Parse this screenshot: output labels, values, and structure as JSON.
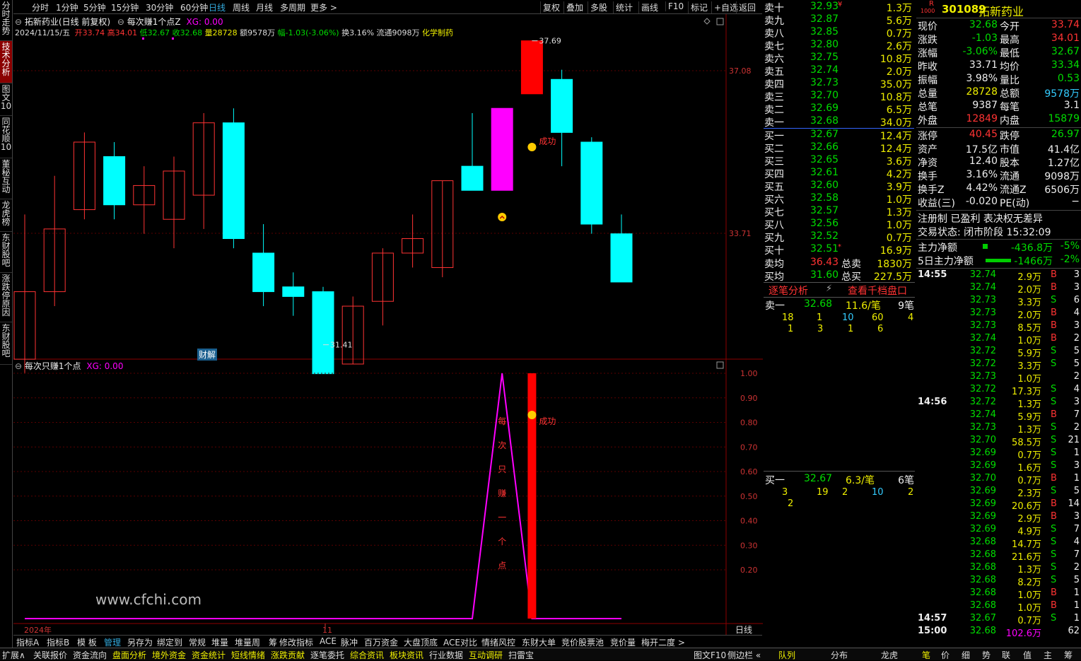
{
  "left_sidebar": [
    {
      "label": "分时走势",
      "active": false
    },
    {
      "label": "技术分析",
      "active": true
    },
    {
      "label": "图文10",
      "active": false
    },
    {
      "label": "同花顺10",
      "active": false
    },
    {
      "label": "董秘互动",
      "active": false
    },
    {
      "label": "龙虎榜",
      "active": false
    },
    {
      "label": "东财股吧",
      "active": false
    },
    {
      "label": "涨跌停原因",
      "active": false
    },
    {
      "label": "东财股吧",
      "active": false
    }
  ],
  "period_tabs": [
    "分时",
    "1分钟",
    "5分钟",
    "15分钟",
    "30分钟",
    "60分钟",
    "日线",
    "周线",
    "月线",
    "多周期",
    "更多 >"
  ],
  "active_period": "日线",
  "top_tools": [
    "复权",
    "叠加",
    "多股",
    "统计",
    "画线",
    "F10",
    "标记",
    "+自选",
    "返回"
  ],
  "kline": {
    "title": "拓新药业(日线 前复权)",
    "indicator": "每次赚1个点Z",
    "xg": "XG: 0.00",
    "date": "2024/11/15/五",
    "open_lbl": "开",
    "open": "33.74",
    "high_lbl": "高",
    "high": "34.01",
    "low_lbl": "低",
    "low": "32.67",
    "close_lbl": "收",
    "close": "32.68",
    "vol_lbl": "量",
    "vol": "28728",
    "amt": "额9578万",
    "chg": "幅-1.03(-3.06%)",
    "turnover": "换3.16%",
    "circ": "流通9098万",
    "sector": "化学制药",
    "price_labels": [
      "37.08",
      "33.71"
    ],
    "max_label": "37.69",
    "min_label": "31.41",
    "success": "成功",
    "caijie": "财解"
  },
  "chart_data": {
    "type": "candlestick",
    "candles": [
      {
        "o": 31.1,
        "h": 34.1,
        "l": 30.8,
        "c": 32.5
      },
      {
        "o": 32.5,
        "h": 34.9,
        "l": 32.2,
        "c": 33.8
      },
      {
        "o": 34.2,
        "h": 35.8,
        "l": 34.0,
        "c": 35.6
      },
      {
        "o": 35.3,
        "h": 35.6,
        "l": 34.0,
        "c": 34.3
      },
      {
        "o": 34.3,
        "h": 35.1,
        "l": 33.7,
        "c": 34.7
      },
      {
        "o": 34.0,
        "h": 35.3,
        "l": 33.4,
        "c": 35.0
      },
      {
        "o": 34.5,
        "h": 36.2,
        "l": 33.8,
        "c": 36.0
      },
      {
        "o": 36.0,
        "h": 36.3,
        "l": 33.4,
        "c": 33.6
      },
      {
        "o": 33.3,
        "h": 33.9,
        "l": 32.2,
        "c": 32.5
      },
      {
        "o": 32.6,
        "h": 32.9,
        "l": 32.0,
        "c": 32.4
      },
      {
        "o": 32.5,
        "h": 32.6,
        "l": 31.4,
        "c": 30.8
      },
      {
        "o": 31.0,
        "h": 32.4,
        "l": 31.0,
        "c": 32.2
      },
      {
        "o": 32.3,
        "h": 33.4,
        "l": 31.8,
        "c": 33.3
      },
      {
        "o": 33.3,
        "h": 34.1,
        "l": 33.0,
        "c": 33.6
      },
      {
        "o": 33.0,
        "h": 34.8,
        "l": 32.8,
        "c": 34.8
      },
      {
        "o": 35.1,
        "h": 36.2,
        "l": 34.8,
        "c": 34.6
      },
      {
        "o": 34.6,
        "h": 36.3,
        "l": 34.6,
        "c": 36.3
      },
      {
        "o": 36.6,
        "h": 37.7,
        "l": 36.6,
        "c": 37.7
      },
      {
        "o": 36.9,
        "h": 37.1,
        "l": 35.1,
        "c": 35.8
      },
      {
        "o": 35.6,
        "h": 35.7,
        "l": 33.7,
        "c": 33.9
      },
      {
        "o": 33.7,
        "h": 34.1,
        "l": 32.7,
        "c": 32.7
      }
    ],
    "indicator_values": [
      0,
      0,
      0,
      0,
      0,
      0,
      0,
      0,
      0,
      0,
      0,
      0,
      0,
      0,
      0,
      0,
      1,
      0,
      0,
      0,
      0
    ],
    "signal_bar_index": 17,
    "indicator_ylabels": [
      "1.00",
      "0.90",
      "0.80",
      "0.70",
      "0.60",
      "0.50",
      "0.40",
      "0.30",
      "0.20"
    ],
    "x_labels": [
      "2024年",
      "11"
    ]
  },
  "sub_title": "每次只赚1个点",
  "sub_xg": "XG: 0.00",
  "signal_text": "每次只赚一个点",
  "watermark": "www.cfchi.com",
  "axis_period": "日线",
  "bottom_tabs": [
    "指标A",
    "指标B",
    "模 板",
    "管理",
    "另存为",
    "绑定到",
    "常规",
    "堆量",
    "堆量周",
    "筹",
    "修改指标",
    "ACE",
    "脉冲",
    "百万资金",
    "大盘顶底",
    "ACE对比",
    "情绪风控",
    "东财大单",
    "竞价股票池",
    "竞价量",
    "梅开二度 >"
  ],
  "active_bottom_tab": "管理",
  "status_bar": [
    {
      "t": "扩展∧",
      "c": "w"
    },
    {
      "t": "关联报价",
      "c": "w"
    },
    {
      "t": "资金流向",
      "c": "w"
    },
    {
      "t": "盘面分析",
      "c": "y"
    },
    {
      "t": "境外资金",
      "c": "y"
    },
    {
      "t": "资金统计",
      "c": "y"
    },
    {
      "t": "短线情绪",
      "c": "y"
    },
    {
      "t": "涨跌贡献",
      "c": "y"
    },
    {
      "t": "逐笔委托",
      "c": "w"
    },
    {
      "t": "综合资讯",
      "c": "y"
    },
    {
      "t": "板块资讯",
      "c": "y"
    },
    {
      "t": "行业数据",
      "c": "w"
    },
    {
      "t": "互动调研",
      "c": "y"
    },
    {
      "t": "扫雷宝",
      "c": "w"
    }
  ],
  "status_right": {
    "a": "图文F10",
    "b": "侧边栏 «",
    "c": "队列",
    "d": "分布",
    "e": "龙虎",
    "f": "笔",
    "g": "价",
    "h": "细",
    "i": "势",
    "j": "联",
    "k": "值",
    "l": "主",
    "m": "筹"
  },
  "orderbook": {
    "sells": [
      {
        "l": "卖十",
        "p": "32.93",
        "v": "1.3万",
        "mk": "¥"
      },
      {
        "l": "卖九",
        "p": "32.87",
        "v": "5.6万"
      },
      {
        "l": "卖八",
        "p": "32.85",
        "v": "0.7万"
      },
      {
        "l": "卖七",
        "p": "32.80",
        "v": "2.6万"
      },
      {
        "l": "卖六",
        "p": "32.75",
        "v": "10.8万"
      },
      {
        "l": "卖五",
        "p": "32.74",
        "v": "2.0万"
      },
      {
        "l": "卖四",
        "p": "32.73",
        "v": "35.0万"
      },
      {
        "l": "卖三",
        "p": "32.70",
        "v": "10.8万"
      },
      {
        "l": "卖二",
        "p": "32.69",
        "v": "6.5万"
      },
      {
        "l": "卖一",
        "p": "32.68",
        "v": "34.0万"
      }
    ],
    "buys": [
      {
        "l": "买一",
        "p": "32.67",
        "v": "12.4万"
      },
      {
        "l": "买二",
        "p": "32.66",
        "v": "12.4万"
      },
      {
        "l": "买三",
        "p": "32.65",
        "v": "3.6万"
      },
      {
        "l": "买四",
        "p": "32.61",
        "v": "4.2万"
      },
      {
        "l": "买五",
        "p": "32.60",
        "v": "3.9万"
      },
      {
        "l": "买六",
        "p": "32.58",
        "v": "1.0万"
      },
      {
        "l": "买七",
        "p": "32.57",
        "v": "1.3万"
      },
      {
        "l": "买八",
        "p": "32.56",
        "v": "1.0万"
      },
      {
        "l": "买九",
        "p": "32.52",
        "v": "0.7万"
      },
      {
        "l": "买十",
        "p": "32.51",
        "v": "16.9万",
        "mk": "*"
      }
    ],
    "avg_sell_l": "卖均",
    "avg_sell": "36.43",
    "total_sell_l": "总卖",
    "total_sell": "1830万",
    "avg_buy_l": "买均",
    "avg_buy": "31.60",
    "total_buy_l": "总买",
    "total_buy": "227.5万",
    "tick_analysis": "逐笔分析",
    "depth1000": "查看千档盘口",
    "s1_lbl": "卖一",
    "s1_p": "32.68",
    "s1_avg": "11.6/笔",
    "s1_n": "9笔",
    "s1_q": [
      [
        "18",
        "1",
        "10",
        "60",
        "4"
      ],
      [
        "1",
        "3",
        "1",
        "6"
      ]
    ],
    "b1_lbl": "买一",
    "b1_p": "32.67",
    "b1_avg": "6.3/笔",
    "b1_n": "6笔",
    "b1_q": [
      [
        "3",
        "19",
        "2",
        "10",
        "2"
      ],
      [
        "2"
      ]
    ]
  },
  "stock": {
    "code": "301089",
    "name": "拓新药业",
    "tag": "R",
    "tag2": "1000"
  },
  "quote": [
    [
      "现价",
      "32.68",
      "今开",
      "33.74"
    ],
    [
      "涨跌",
      "-1.03",
      "最高",
      "34.01"
    ],
    [
      "涨幅",
      "-3.06%",
      "最低",
      "32.67"
    ],
    [
      "昨收",
      "33.71",
      "均价",
      "33.34"
    ],
    [
      "振幅",
      "3.98%",
      "量比",
      "0.53"
    ],
    [
      "总量",
      "28728",
      "总额",
      "9578万"
    ],
    [
      "总笔",
      "9387",
      "每笔",
      "3.1"
    ],
    [
      "外盘",
      "12849",
      "内盘",
      "15879"
    ],
    [
      "涨停",
      "40.45",
      "跌停",
      "26.97"
    ],
    [
      "资产",
      "17.5亿",
      "市值",
      "41.4亿"
    ],
    [
      "净资",
      "12.40",
      "股本",
      "1.27亿"
    ],
    [
      "换手",
      "3.16%",
      "流通",
      "9098万"
    ],
    [
      "换手Z",
      "4.42%",
      "流通Z",
      "6506万"
    ],
    [
      "收益(三)",
      "-0.020",
      "PE(动)",
      "−"
    ]
  ],
  "info_line1": "注册制 已盈利 表决权无差异",
  "info_line2": "交易状态: 闭市阶段 15:32:09",
  "flows": [
    {
      "l": "主力净额",
      "v": "-436.8万",
      "p": "-5%"
    },
    {
      "l": "5日主力净额",
      "v": "-1466万",
      "p": "-2%"
    }
  ],
  "ticks": [
    {
      "t": "14:55",
      "p": "32.74",
      "v": "2.9万",
      "s": "B",
      "n": "3"
    },
    {
      "t": "",
      "p": "32.74",
      "v": "2.0万",
      "s": "B",
      "n": "3"
    },
    {
      "t": "",
      "p": "32.73",
      "v": "3.3万",
      "s": "S",
      "n": "6"
    },
    {
      "t": "",
      "p": "32.73",
      "v": "2.0万",
      "s": "B",
      "n": "4"
    },
    {
      "t": "",
      "p": "32.73",
      "v": "8.5万",
      "s": "B",
      "n": "3"
    },
    {
      "t": "",
      "p": "32.74",
      "v": "1.0万",
      "s": "B",
      "n": "2"
    },
    {
      "t": "",
      "p": "32.72",
      "v": "5.9万",
      "s": "S",
      "n": "5"
    },
    {
      "t": "",
      "p": "32.72",
      "v": "3.3万",
      "s": "S",
      "n": "5"
    },
    {
      "t": "",
      "p": "32.73",
      "v": "1.0万",
      "s": "",
      "n": "2"
    },
    {
      "t": "",
      "p": "32.72",
      "v": "17.3万",
      "s": "S",
      "n": "4"
    },
    {
      "t": "14:56",
      "p": "32.72",
      "v": "1.3万",
      "s": "S",
      "n": "3"
    },
    {
      "t": "",
      "p": "32.74",
      "v": "5.9万",
      "s": "B",
      "n": "7"
    },
    {
      "t": "",
      "p": "32.73",
      "v": "1.3万",
      "s": "S",
      "n": "2"
    },
    {
      "t": "",
      "p": "32.70",
      "v": "58.5万",
      "s": "S",
      "n": "21"
    },
    {
      "t": "",
      "p": "32.69",
      "v": "0.7万",
      "s": "S",
      "n": "1"
    },
    {
      "t": "",
      "p": "32.69",
      "v": "1.6万",
      "s": "S",
      "n": "3"
    },
    {
      "t": "",
      "p": "32.70",
      "v": "0.7万",
      "s": "B",
      "n": "1"
    },
    {
      "t": "",
      "p": "32.69",
      "v": "2.3万",
      "s": "S",
      "n": "5"
    },
    {
      "t": "",
      "p": "32.69",
      "v": "20.6万",
      "s": "B",
      "n": "14"
    },
    {
      "t": "",
      "p": "32.69",
      "v": "2.9万",
      "s": "B",
      "n": "3"
    },
    {
      "t": "",
      "p": "32.69",
      "v": "4.9万",
      "s": "S",
      "n": "7"
    },
    {
      "t": "",
      "p": "32.68",
      "v": "14.7万",
      "s": "S",
      "n": "4"
    },
    {
      "t": "",
      "p": "32.68",
      "v": "21.6万",
      "s": "S",
      "n": "7"
    },
    {
      "t": "",
      "p": "32.68",
      "v": "1.3万",
      "s": "S",
      "n": "2"
    },
    {
      "t": "",
      "p": "32.68",
      "v": "8.2万",
      "s": "S",
      "n": "5"
    },
    {
      "t": "",
      "p": "32.68",
      "v": "1.0万",
      "s": "B",
      "n": "1"
    },
    {
      "t": "",
      "p": "32.68",
      "v": "1.0万",
      "s": "B",
      "n": "1"
    },
    {
      "t": "14:57",
      "p": "32.67",
      "v": "0.7万",
      "s": "S",
      "n": "1"
    },
    {
      "t": "15:00",
      "p": "32.68",
      "v": "102.6万",
      "s": "",
      "n": "62"
    }
  ]
}
